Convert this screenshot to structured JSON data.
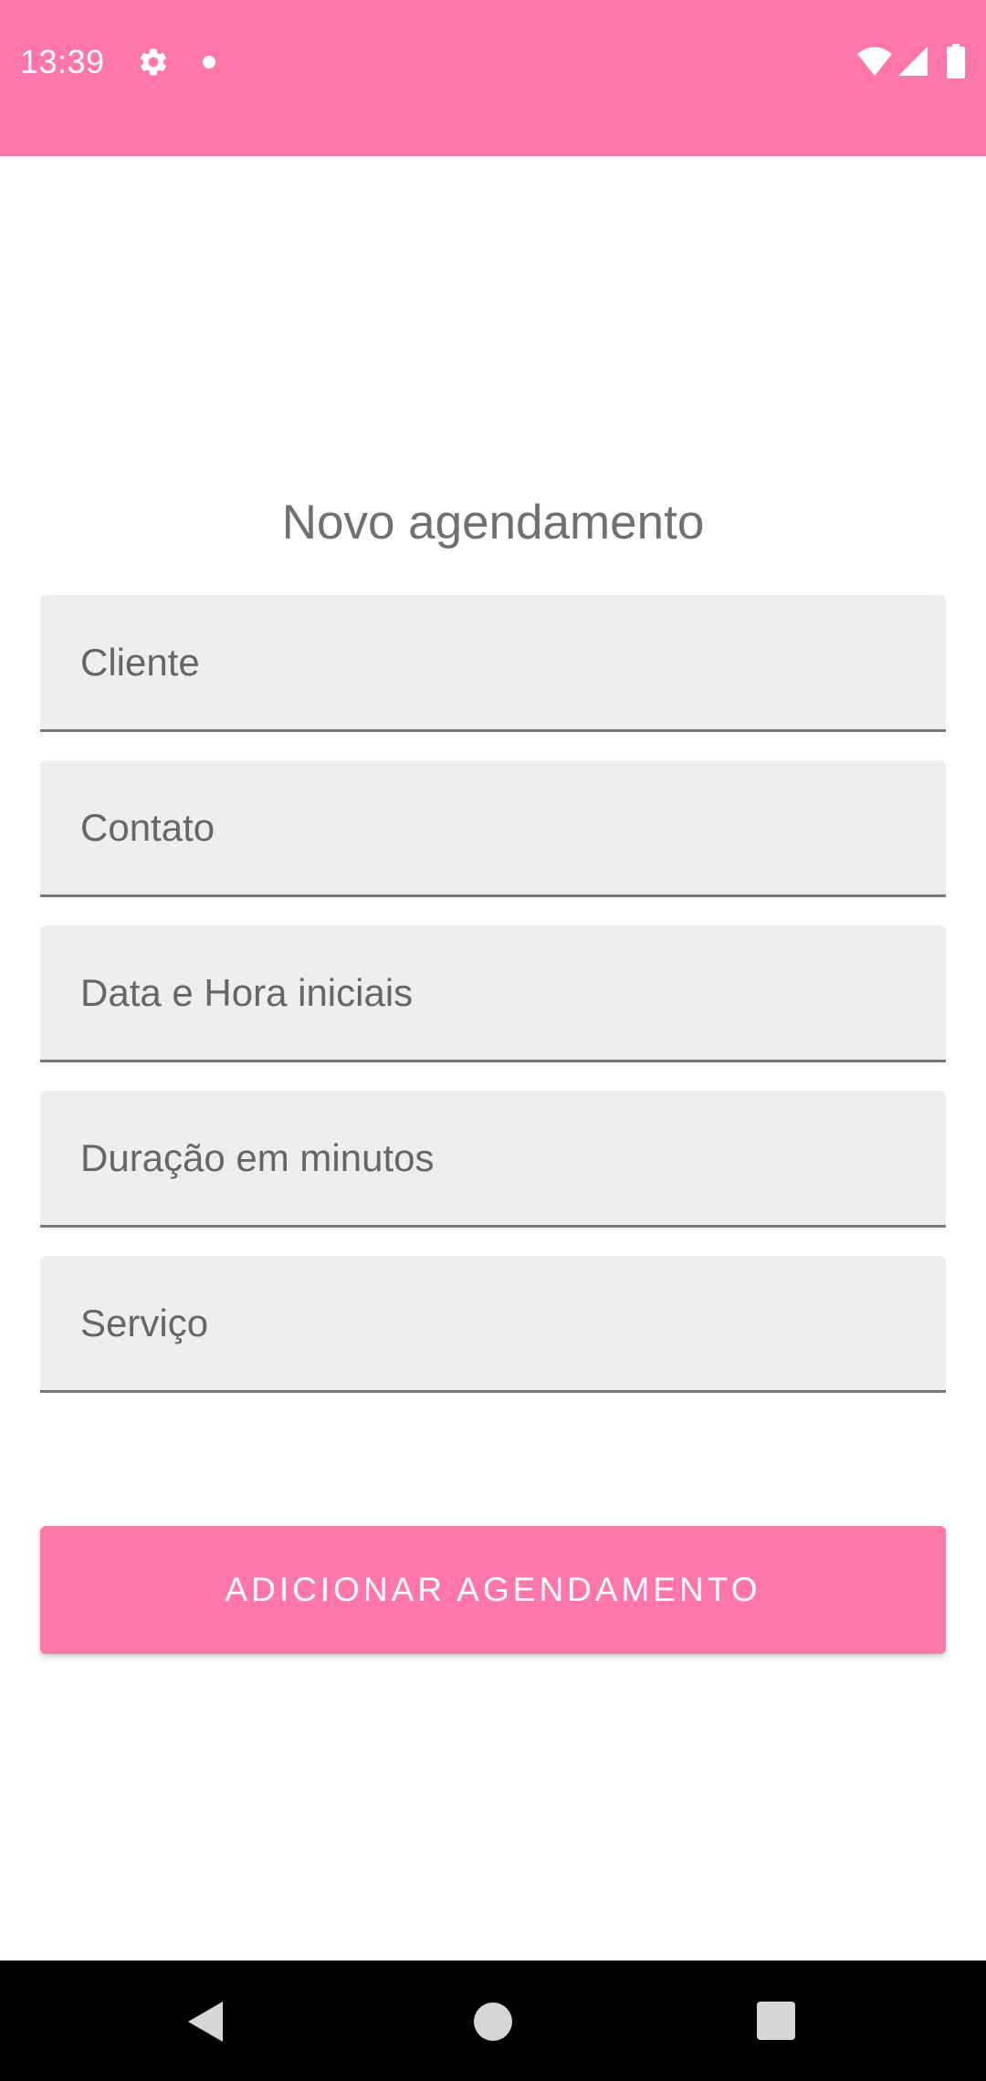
{
  "status_bar": {
    "time": "13:39",
    "background_color": "#ff77a8",
    "icons": [
      "gear-icon",
      "notification-dot-icon",
      "wifi-icon",
      "cell-signal-icon",
      "battery-icon"
    ]
  },
  "form": {
    "title": "Novo agendamento",
    "fields": {
      "cliente": {
        "placeholder": "Cliente",
        "value": ""
      },
      "contato": {
        "placeholder": "Contato",
        "value": ""
      },
      "data_hora": {
        "placeholder": "Data e Hora iniciais",
        "value": ""
      },
      "duracao": {
        "placeholder": "Duração em minutos",
        "value": ""
      },
      "servico": {
        "placeholder": "Serviço",
        "value": ""
      }
    },
    "submit_label": "ADICIONAR AGENDAMENTO",
    "accent_color": "#ff77a8"
  },
  "nav_bar": {
    "icons": [
      "back-icon",
      "home-icon",
      "recents-icon"
    ]
  }
}
